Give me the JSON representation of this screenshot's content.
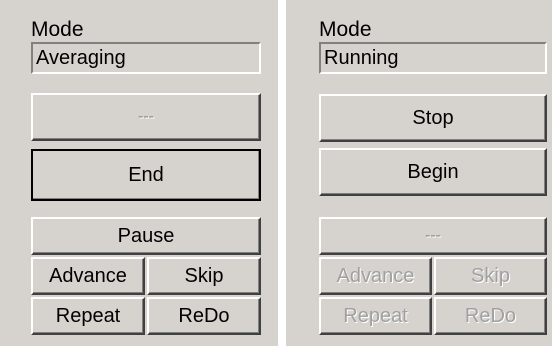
{
  "left_panel": {
    "mode_label": "Mode",
    "mode_value": "Averaging",
    "btn_top": "---",
    "btn_end": "End",
    "btn_pause": "Pause",
    "btn_advance": "Advance",
    "btn_skip": "Skip",
    "btn_repeat": "Repeat",
    "btn_redo": "ReDo"
  },
  "right_panel": {
    "mode_label": "Mode",
    "mode_value": "Running",
    "btn_stop": "Stop",
    "btn_begin": "Begin",
    "btn_dashes": "---",
    "btn_advance": "Advance",
    "btn_skip": "Skip",
    "btn_repeat": "Repeat",
    "btn_redo": "ReDo"
  }
}
